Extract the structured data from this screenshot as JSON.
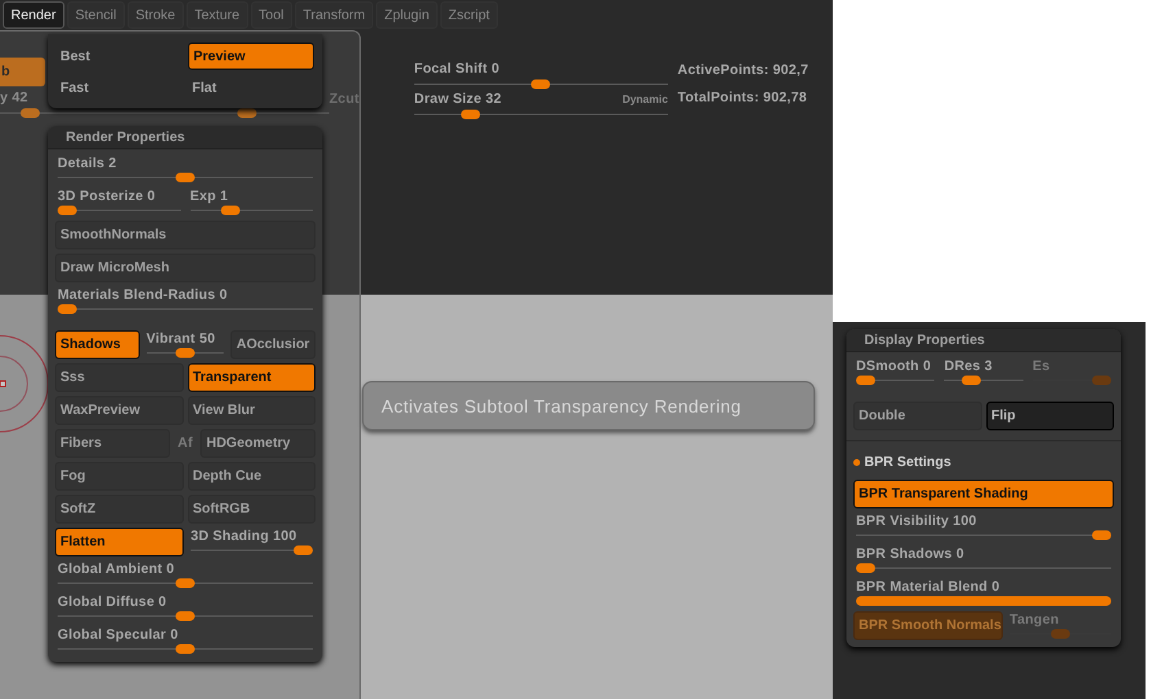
{
  "tabs": [
    {
      "label": "Render",
      "selected": true
    },
    {
      "label": "Stencil",
      "selected": false
    },
    {
      "label": "Stroke",
      "selected": false
    },
    {
      "label": "Texture",
      "selected": false
    },
    {
      "label": "Tool",
      "selected": false
    },
    {
      "label": "Transform",
      "selected": false
    },
    {
      "label": "Zplugin",
      "selected": false
    },
    {
      "label": "Zscript",
      "selected": false
    }
  ],
  "toolbar": {
    "partial_button": {
      "label": "b",
      "on": true
    },
    "partial_slider": {
      "label": "y 42",
      "level": 0.13
    },
    "zcut": {
      "label": "Zcut",
      "level": 0.45
    },
    "focal_shift": {
      "label": "Focal Shift 0",
      "level": 0.5
    },
    "draw_size": {
      "label": "Draw Size 32",
      "level": 0.2
    },
    "dynamic": "Dynamic",
    "stats": [
      "ActivePoints: 902,7",
      "TotalPoints: 902,78"
    ]
  },
  "render_mode_menu": [
    {
      "label": "Best",
      "selected": false
    },
    {
      "label": "Preview",
      "selected": true
    },
    {
      "label": "Fast",
      "selected": false
    },
    {
      "label": "Flat",
      "selected": false
    }
  ],
  "render_properties": {
    "title": "Render Properties",
    "sections": [
      {
        "divider": false,
        "rows": [
          {
            "kind": "cells",
            "cells": [
              {
                "kind": "slider",
                "label": "Details 2",
                "level": 0.5
              }
            ]
          },
          {
            "kind": "cells",
            "cells": [
              {
                "kind": "slider",
                "label": "3D Posterize 0",
                "level": 0
              },
              {
                "kind": "slider",
                "label": "Exp 1",
                "level": 0.3
              }
            ]
          },
          {
            "kind": "cells",
            "cells": [
              {
                "kind": "button",
                "label": "SmoothNormals",
                "on": false
              }
            ]
          },
          {
            "kind": "cells",
            "cells": [
              {
                "kind": "button",
                "label": "Draw MicroMesh",
                "on": false
              }
            ]
          },
          {
            "kind": "cells",
            "cells": [
              {
                "kind": "slider",
                "label": "Materials Blend-Radius 0",
                "level": 0
              }
            ]
          }
        ]
      },
      {
        "divider": false,
        "rows": [
          {
            "kind": "cells",
            "cells": [
              {
                "kind": "button",
                "label": "Shadows",
                "on": true
              },
              {
                "kind": "slider",
                "label": "Vibrant 50",
                "level": 0.5
              },
              {
                "kind": "button",
                "label": "AOcclusior",
                "on": false
              }
            ]
          },
          {
            "kind": "cells",
            "cells": [
              {
                "kind": "button",
                "label": "Sss",
                "on": false
              },
              {
                "kind": "button",
                "label": "Transparent",
                "on": true
              }
            ]
          },
          {
            "kind": "cells",
            "cells": [
              {
                "kind": "button",
                "label": "WaxPreview",
                "on": false
              },
              {
                "kind": "button",
                "label": "View Blur",
                "on": false
              }
            ]
          },
          {
            "kind": "cells",
            "cells": [
              {
                "kind": "button",
                "label": "Fibers",
                "on": false
              },
              {
                "kind": "text",
                "label": "Af",
                "disabled": true
              },
              {
                "kind": "button",
                "label": "HDGeometry",
                "on": false
              }
            ]
          },
          {
            "kind": "cells",
            "cells": [
              {
                "kind": "button",
                "label": "Fog",
                "on": false
              },
              {
                "kind": "button",
                "label": "Depth Cue",
                "on": false
              }
            ]
          },
          {
            "kind": "cells",
            "cells": [
              {
                "kind": "button",
                "label": "SoftZ",
                "on": false
              },
              {
                "kind": "button",
                "label": "SoftRGB",
                "on": false
              }
            ]
          },
          {
            "kind": "cells",
            "cells": [
              {
                "kind": "button",
                "label": "Flatten",
                "on": true
              },
              {
                "kind": "slider",
                "label": "3D Shading 100",
                "level": 1
              }
            ]
          },
          {
            "kind": "cells",
            "cells": [
              {
                "kind": "slider",
                "label": "Global Ambient 0",
                "level": 0.5
              }
            ]
          },
          {
            "kind": "cells",
            "cells": [
              {
                "kind": "slider",
                "label": "Global Diffuse 0",
                "level": 0.5
              }
            ]
          },
          {
            "kind": "cells",
            "cells": [
              {
                "kind": "slider",
                "label": "Global Specular 0",
                "level": 0.5
              }
            ]
          }
        ]
      }
    ]
  },
  "tooltip": "Activates Subtool Transparency Rendering",
  "display_properties": {
    "title": "Display Properties",
    "sections": [
      {
        "divider": false,
        "rows": [
          {
            "kind": "cells",
            "cells": [
              {
                "kind": "slider",
                "label": "DSmooth 0",
                "level": 0
              },
              {
                "kind": "slider",
                "label": "DRes 3",
                "level": 0.3
              },
              {
                "kind": "slider",
                "label": "Es",
                "level": 1,
                "disabled": true
              }
            ]
          }
        ]
      },
      {
        "divider": false,
        "rows": [
          {
            "kind": "cells",
            "cells": [
              {
                "kind": "button",
                "label": "Double",
                "on": false
              },
              {
                "kind": "button",
                "label": "Flip",
                "on": false,
                "pressed": true
              }
            ]
          }
        ]
      },
      {
        "divider": true,
        "rows": [
          {
            "kind": "header",
            "label": "BPR Settings",
            "expanded": true
          },
          {
            "kind": "cells",
            "cells": [
              {
                "kind": "button",
                "label": "BPR Transparent Shading",
                "on": true
              }
            ]
          },
          {
            "kind": "cells",
            "cells": [
              {
                "kind": "slider",
                "label": "BPR Visibility 100",
                "level": 1
              }
            ]
          },
          {
            "kind": "cells",
            "cells": [
              {
                "kind": "slider",
                "label": "BPR Shadows 0",
                "level": 0
              }
            ]
          },
          {
            "kind": "cells",
            "cells": [
              {
                "kind": "fill_slider",
                "label": "BPR Material Blend 0",
                "level": 1
              }
            ]
          },
          {
            "kind": "cells",
            "cells": [
              {
                "kind": "button",
                "label": "BPR Smooth Normals",
                "on": true,
                "disabled": true
              },
              {
                "kind": "slider",
                "label": "Tangen",
                "level": 0.5,
                "disabled": true
              }
            ]
          }
        ]
      }
    ]
  }
}
